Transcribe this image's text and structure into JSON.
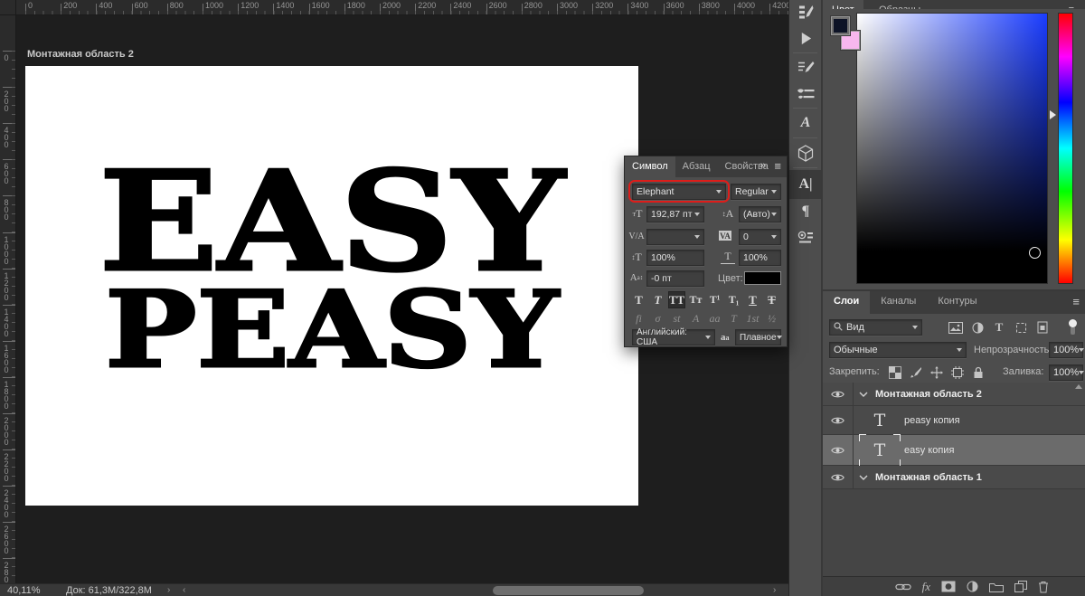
{
  "rulers": {
    "top": [
      "0",
      "200",
      "400",
      "600",
      "800",
      "1000",
      "1200",
      "1400",
      "1600",
      "1800",
      "2000",
      "2200",
      "2400",
      "2600",
      "2800",
      "3000",
      "3200",
      "3400",
      "3600",
      "3800",
      "4000",
      "4200"
    ],
    "left": [
      "0",
      "200",
      "400",
      "600",
      "800",
      "1000",
      "1200",
      "1400",
      "1600",
      "1800",
      "2000",
      "2200",
      "2400",
      "2600",
      "2800"
    ]
  },
  "artboard": {
    "label": "Монтажная область 2",
    "line1": "EASY",
    "line2": "PEASY"
  },
  "character_panel": {
    "tabs": [
      {
        "label": "Символ",
        "active": true
      },
      {
        "label": "Абзац",
        "active": false
      },
      {
        "label": "Свойства",
        "active": false
      }
    ],
    "expand_icon": "»",
    "menu_icon": "≡",
    "font_family": "Elephant",
    "font_style": "Regular",
    "font_size": "192,87 пт",
    "leading": "(Авто)",
    "kerning": "",
    "tracking": "0",
    "vertical_scale": "100%",
    "horizontal_scale": "100%",
    "baseline_shift": "-0 пт",
    "color_label": "Цвет:",
    "style_buttons": [
      {
        "glyph": "T",
        "name": "faux-bold",
        "active": false
      },
      {
        "glyph": "T",
        "name": "faux-italic",
        "active": false
      },
      {
        "glyph": "TT",
        "name": "all-caps",
        "active": true
      },
      {
        "glyph": "Tт",
        "name": "small-caps",
        "active": false
      },
      {
        "glyph": "T¹",
        "name": "superscript",
        "active": false
      },
      {
        "glyph": "T₁",
        "name": "subscript",
        "active": false
      },
      {
        "glyph": "T",
        "name": "underline",
        "active": false
      },
      {
        "glyph": "T",
        "name": "strikethrough",
        "active": false
      }
    ],
    "opentype_buttons": [
      {
        "glyph": "fi",
        "name": "ligatures"
      },
      {
        "glyph": "σ",
        "name": "contextual-alternates"
      },
      {
        "glyph": "st",
        "name": "discretionary-ligatures"
      },
      {
        "glyph": "A",
        "name": "swash"
      },
      {
        "glyph": "aa",
        "name": "stylistic-alternates"
      },
      {
        "glyph": "T",
        "name": "titling-alternates"
      },
      {
        "glyph": "1st",
        "name": "ordinals"
      },
      {
        "glyph": "½",
        "name": "fractions"
      }
    ],
    "language": "Английский: США",
    "antialias": "Плавное"
  },
  "color_panel": {
    "tabs": [
      {
        "label": "Цвет",
        "active": true
      },
      {
        "label": "Образцы",
        "active": false
      }
    ],
    "foreground_color": "#0d1326",
    "background_color": "#f7b7ee",
    "hue_selected": "#1a3cff"
  },
  "layers_panel": {
    "tabs": [
      {
        "label": "Слои",
        "active": true
      },
      {
        "label": "Каналы",
        "active": false
      },
      {
        "label": "Контуры",
        "active": false
      }
    ],
    "filter_label": "Вид",
    "filter_icons": [
      "pixel-layers-filter-icon",
      "adjustment-layers-filter-icon",
      "type-layers-filter-icon",
      "shape-layers-filter-icon",
      "smart-objects-filter-icon"
    ],
    "blend_mode": "Обычные",
    "opacity_label": "Непрозрачность:",
    "opacity_value": "100%",
    "lock_label": "Закрепить:",
    "lock_icons": [
      "lock-transparency-icon",
      "lock-pixels-icon",
      "lock-position-icon",
      "lock-artboard-icon",
      "lock-all-icon"
    ],
    "fill_label": "Заливка:",
    "fill_value": "100%",
    "layers": [
      {
        "name": "Монтажная область 2",
        "type": "artboard",
        "selected": false
      },
      {
        "name": "peasy копия",
        "type": "text",
        "selected": false
      },
      {
        "name": "easy копия",
        "type": "text",
        "selected": true
      },
      {
        "name": "Монтажная область 1",
        "type": "artboard",
        "selected": false
      }
    ],
    "footer_icons": [
      "link-layers-icon",
      "layer-effects-icon",
      "layer-mask-icon",
      "adjustment-layer-icon",
      "layer-group-icon",
      "new-layer-icon",
      "delete-layer-icon"
    ]
  },
  "dock": {
    "icons": [
      "tool-presets-icon",
      "actions-play-icon",
      "sep",
      "brush-settings-icon",
      "brushes-icon",
      "sep",
      "glyphs-icon",
      "sep",
      "3d-icon",
      "sep",
      "character-panel-icon",
      "paragraph-panel-icon",
      "opentype-panel-icon"
    ],
    "active": "character-panel-icon"
  },
  "status_bar": {
    "zoom": "40,11%",
    "doc": "Док: 61,3M/322,8M"
  },
  "colors": {
    "highlight_red": "#dd1d1a",
    "canvas_text": "#000000",
    "artboard_bg": "#ffffff"
  }
}
